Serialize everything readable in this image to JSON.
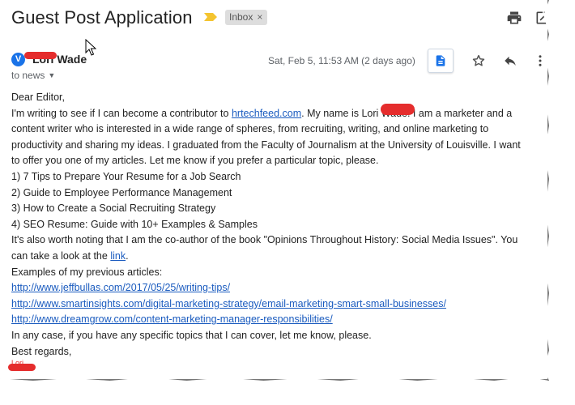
{
  "email": {
    "subject": "Guest Post Application",
    "label": "Inbox",
    "label_remove": "×",
    "sender_name": "Lori Wade",
    "sender_initial": "V",
    "to_line": "to news",
    "date": "Sat, Feb 5, 11:53 AM (2 days ago)"
  },
  "body": {
    "greeting": "Dear Editor,",
    "p1_a": "I'm writing to see if I can become a contributor to ",
    "p1_link": "hrtechfeed.com",
    "p1_b": ". My name is Lori Wade. I am a marketer and a",
    "p2": "content writer who is interested in a wide range of spheres, from recruiting, writing, and online marketing to",
    "p3": "productivity and sharing my ideas. I graduated from the Faculty of Journalism at the University of Louisville. I want",
    "p4": "to offer you one of my articles. Let me know if you prefer a particular topic, please.",
    "topics": [
      "1) 7 Tips to Prepare Your Resume for a Job Search",
      "2) Guide to Employee Performance Management",
      "3) How to Create a Social Recruiting Strategy",
      "4) SEO Resume: Guide with 10+ Examples & Samples"
    ],
    "p5": "It's also worth noting that I am the co-author of the book \"Opinions Throughout History: Social Media Issues\". You",
    "p6_a": "can take a look at the ",
    "p6_link": "link",
    "p6_b": ".",
    "examples_intro": "Examples of my previous articles:",
    "links": [
      "http://www.jeffbullas.com/2017/05/25/writing-tips/",
      "http://www.smartinsights.com/digital-marketing-strategy/email-marketing-smart-small-businesses/",
      "http://www.dreamgrow.com/content-marketing-manager-responsibilities/"
    ],
    "closing1": "In any case, if you have any specific topics that I can cover, let me know, please.",
    "closing2": "Best regards,",
    "signature": "Lori"
  },
  "colors": {
    "link": "#1a5bbf",
    "redaction": "#e52d2d",
    "important_marker": "#f4c430"
  }
}
